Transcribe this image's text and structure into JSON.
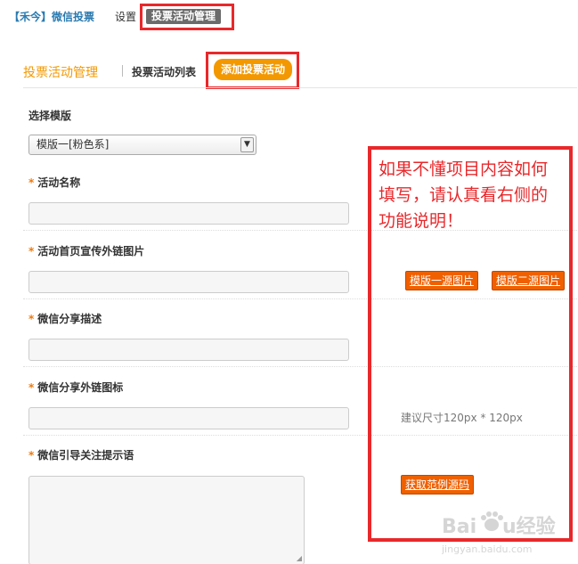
{
  "topnav": {
    "brand": "【禾今】微信投票",
    "settings": "设置",
    "manage": "投票活动管理"
  },
  "subheader": {
    "title": "投票活动管理",
    "list": "投票活动列表",
    "add": "添加投票活动"
  },
  "form": {
    "template_label": "选择模版",
    "template_value": "模版一[粉色系]",
    "star": "*",
    "activity_name_label": "活动名称",
    "cover_image_label": "活动首页宣传外链图片",
    "share_desc_label": "微信分享描述",
    "share_icon_label": "微信分享外链图标",
    "follow_tip_label": "微信引导关注提示语"
  },
  "help": {
    "note": "如果不懂项目内容如何填写，请认真看右侧的功能说明！",
    "template1_btn": "模版一源图片",
    "template2_btn": "模版二源图片",
    "size_hint": "建议尺寸120px * 120px",
    "source_btn": "获取范例源码"
  },
  "watermark": {
    "brand": "Baidu经验",
    "url": "jingyan.baidu.com"
  },
  "colors": {
    "accent_orange": "#f39800",
    "highlight_red": "#e8282b",
    "brand_blue": "#2a7ab0"
  }
}
